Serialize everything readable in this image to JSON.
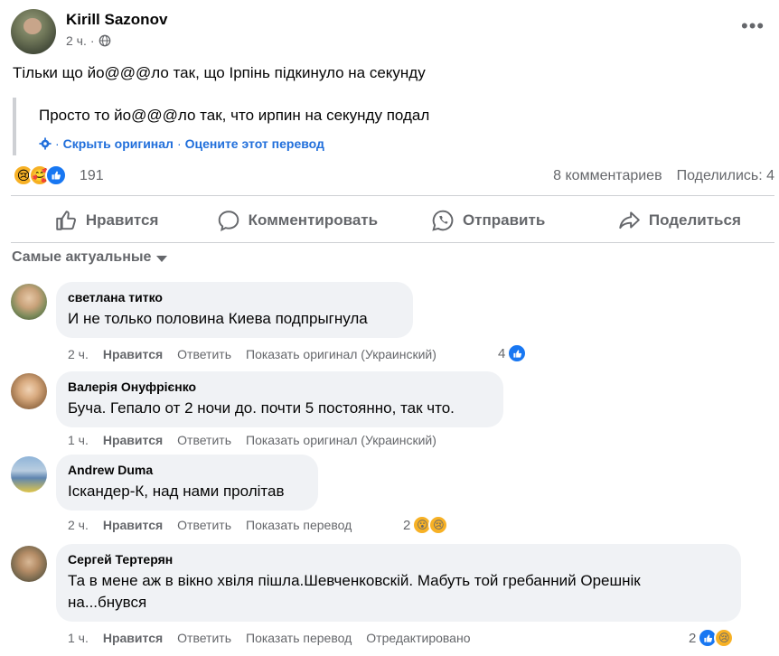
{
  "post": {
    "author": "Kirill Sazonov",
    "time": "2 ч.",
    "separator": "·",
    "text": "Тільки що йо@@@ло так, що Ірпінь підкинуло на секунду",
    "translation": "Просто то йо@@@ло так, что ирпин на секунду подал",
    "hide_original": "Скрыть оригинал",
    "rate_translation": "Оцените этот перевод",
    "reaction_count": "191",
    "comments_count": "8 комментариев",
    "shares_count": "Поделились: 4"
  },
  "actions": {
    "like": "Нравится",
    "comment": "Комментировать",
    "send": "Отправить",
    "share": "Поделиться"
  },
  "sort_label": "Самые актуальные",
  "comments": [
    {
      "author": "светлана титко",
      "text": "И не только половина Киева подпрыгнула",
      "time": "2 ч.",
      "like": "Нравится",
      "reply": "Ответить",
      "extra": "Показать оригинал (Украинский)",
      "reaction_count": "4"
    },
    {
      "author": "Валерія Онуфрієнко",
      "text": "Буча. Гепало от 2 ночи до. почти 5 постоянно, так что.",
      "time": "1 ч.",
      "like": "Нравится",
      "reply": "Ответить",
      "extra": "Показать оригинал (Украинский)"
    },
    {
      "author": "Andrew Duma",
      "text": "Іскандер-К, над нами пролітав",
      "time": "2 ч.",
      "like": "Нравится",
      "reply": "Ответить",
      "extra": "Показать перевод",
      "reaction_count": "2"
    },
    {
      "author": "Сергей Тертерян",
      "text_line1": "Та в мене аж в вікно хвіля пішла.Шевченковскій. Мабуть той гребанний Орешнік",
      "text_line2": "на...бнувся",
      "time": "1 ч.",
      "like": "Нравится",
      "reply": "Ответить",
      "extra": "Показать перевод",
      "edited": "Отредактировано",
      "reaction_count": "2"
    }
  ],
  "colors": {
    "link": "#216fdb",
    "secondary_text": "#65676b",
    "bubble": "#f0f2f5",
    "like_blue": "#1877f2",
    "emoji_yellow": "#f7b125"
  },
  "icons": [
    "globe-icon",
    "more-icon",
    "gear-icon",
    "like-icon",
    "comment-icon",
    "whatsapp-icon",
    "share-icon",
    "caret-down-icon"
  ]
}
